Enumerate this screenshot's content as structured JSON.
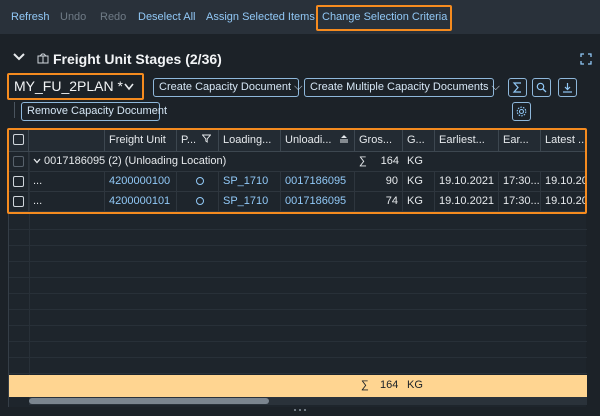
{
  "toolbar": {
    "refresh": "Refresh",
    "undo": "Undo",
    "redo": "Redo",
    "deselect_all": "Deselect All",
    "assign_selected": "Assign Selected Items",
    "change_criteria": "Change Selection Criteria"
  },
  "panel": {
    "title": "Freight Unit Stages (2/36)",
    "variant": "MY_FU_2PLAN *"
  },
  "actions": {
    "create_capacity": "Create Capacity Document",
    "create_multiple": "Create Multiple Capacity Documents",
    "remove_capacity": "Remove Capacity Document"
  },
  "table": {
    "headers": {
      "freight_unit": "Freight Unit",
      "p": "P...",
      "loading": "Loading...",
      "unloading": "Unloadi...",
      "gross": "Gros...",
      "g": "G...",
      "earliest": "Earliest...",
      "ear": "Ear...",
      "latest": "Latest ..."
    },
    "group": {
      "label": "0017186095 (2) (Unloading Location)",
      "sum_symbol": "∑",
      "gross": "164",
      "unit": "KG"
    },
    "rows": [
      {
        "more": "...",
        "freight_unit": "4200000100",
        "loading": "SP_1710",
        "unloading": "0017186095",
        "gross": "90",
        "unit": "KG",
        "earliest": "19.10.2021",
        "ear": "17:30...",
        "latest": "19.10.20"
      },
      {
        "more": "...",
        "freight_unit": "4200000101",
        "loading": "SP_1710",
        "unloading": "0017186095",
        "gross": "74",
        "unit": "KG",
        "earliest": "19.10.2021",
        "ear": "17:30...",
        "latest": "19.10.20"
      }
    ],
    "totals": {
      "sum_symbol": "∑",
      "gross": "164",
      "unit": "KG"
    }
  },
  "colors": {
    "accent": "#f58b1f",
    "link": "#91c8f6",
    "totals_bg": "#ffd591"
  }
}
